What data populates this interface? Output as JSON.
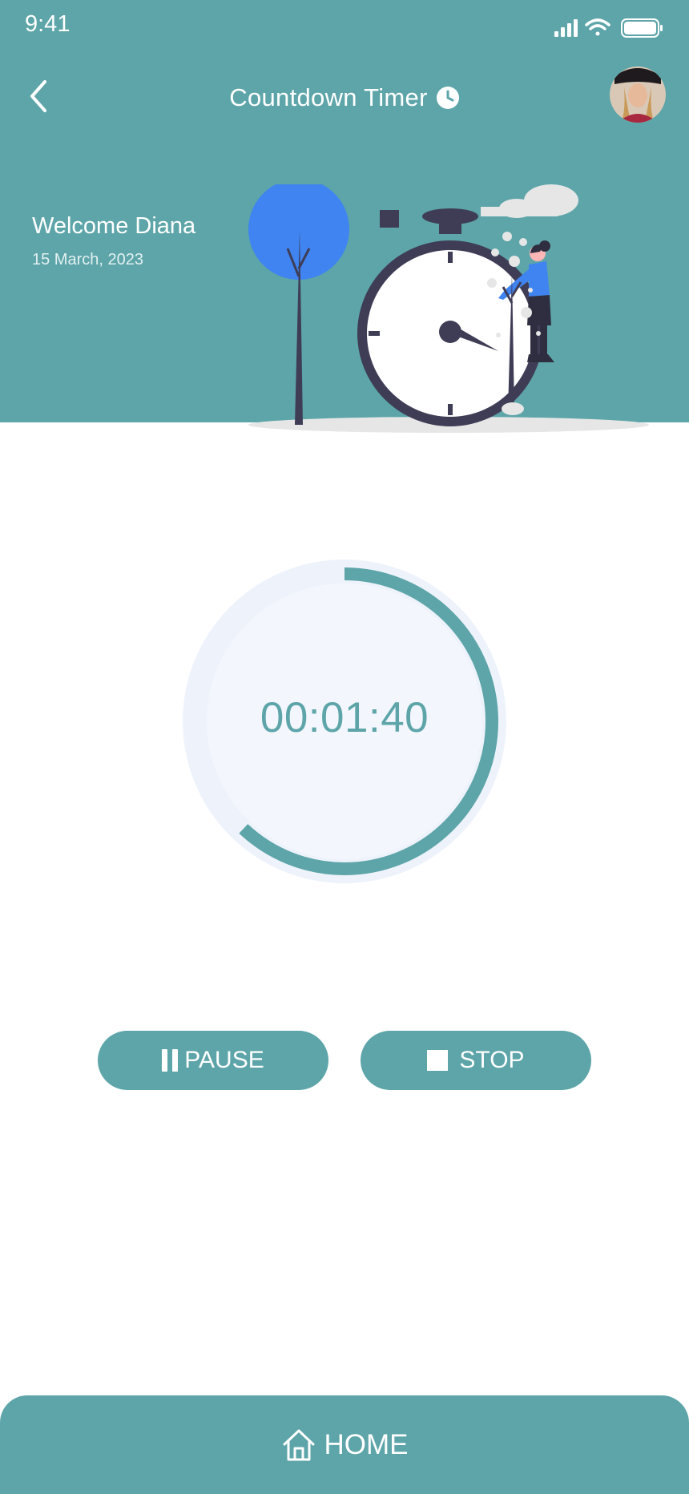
{
  "status_bar": {
    "time": "9:41",
    "icons": [
      "signal-icon",
      "wifi-icon",
      "battery-icon"
    ]
  },
  "header": {
    "title": "Countdown Timer",
    "title_icon": "clock-icon",
    "back_icon": "chevron-left-icon",
    "welcome": "Welcome Diana",
    "date": "15 March, 2023"
  },
  "timer": {
    "display": "00:01:40",
    "progress": 0.62
  },
  "controls": {
    "pause_label": "PAUSE",
    "stop_label": "STOP"
  },
  "nav": {
    "home_label": "HOME",
    "home_icon": "home-icon"
  },
  "colors": {
    "accent": "#5da5a9",
    "ring_track": "#eef3fb",
    "ring_inner": "#f3f6fd"
  }
}
